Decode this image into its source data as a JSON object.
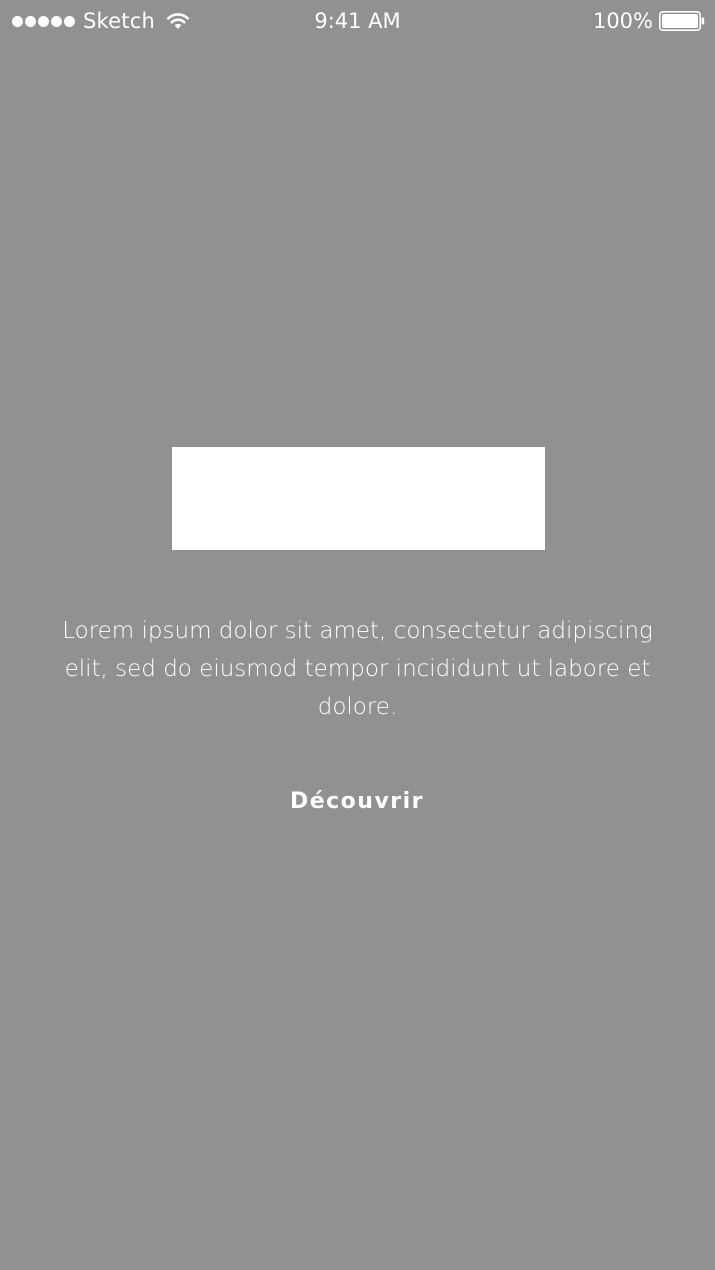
{
  "status_bar": {
    "carrier": "Sketch",
    "time": "9:41 AM",
    "battery_percent": "100%",
    "signal_icon": "signal-dots-icon",
    "wifi_icon": "wifi-icon",
    "battery_icon": "battery-icon"
  },
  "main": {
    "description": "Lorem ipsum dolor sit amet, consectetur adipiscing elit, sed do eiusmod tempor incididunt ut labore et dolore.",
    "cta_label": "Découvrir"
  },
  "colors": {
    "background": "#919191",
    "foreground": "#ffffff"
  }
}
